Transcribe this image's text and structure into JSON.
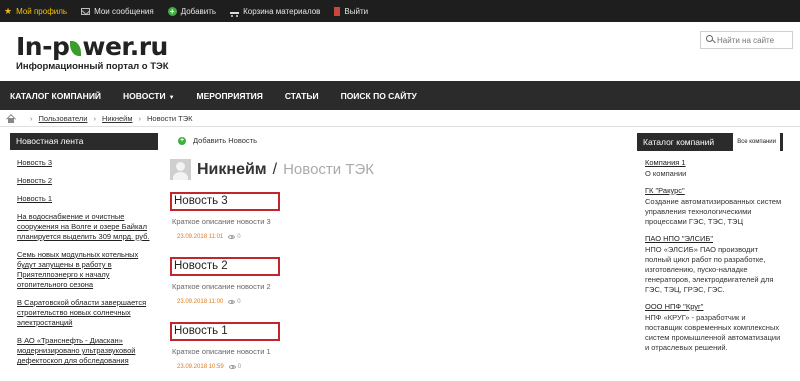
{
  "topbar": {
    "items": [
      {
        "label": "Мой профиль",
        "icon": "star-icon"
      },
      {
        "label": "Мои сообщения",
        "icon": "mail-icon"
      },
      {
        "label": "Добавить",
        "icon": "plus-icon"
      },
      {
        "label": "Корзина материалов",
        "icon": "cart-icon"
      },
      {
        "label": "Выйти",
        "icon": "exit-icon"
      }
    ],
    "active_color": "#f2c200"
  },
  "header": {
    "logo_left": "In-p",
    "logo_right": "wer.ru",
    "tagline": "Информационный портал о ТЭК",
    "search_placeholder": "Найти на сайте"
  },
  "nav": {
    "items": [
      "КАТАЛОГ КОМПАНИЙ",
      "НОВОСТИ",
      "МЕРОПРИЯТИЯ",
      "СТАТЬИ",
      "ПОИСК ПО САЙТУ"
    ]
  },
  "breadcrumb": {
    "items": [
      "Пользователи",
      "Никнейм",
      "Новости ТЭК"
    ]
  },
  "left": {
    "title": "Новостная лента",
    "items": [
      "Новость 3",
      "Новость 2",
      "Новость 1",
      "На водоснабжение и очистные сооружения на Волге и озере Байкал планируется выделить 309 млрд. руб.",
      "Семь новых модульных котельных будут запущены в работу в Приятелпоэнерго к началу отопительного сезона",
      "В Саратовской области завершается строительство новых солнечных электростанций",
      "В АО «Транснефть - Диаскан» модернизировано ультразвуковой дефектоскоп для обследования"
    ]
  },
  "center": {
    "add_label": "Добавить Новость",
    "nickname": "Никнейм",
    "slash": "/",
    "section": "Новости ТЭК",
    "posts": [
      {
        "title": "Новость 3",
        "desc": "Краткое описание новости 3",
        "date": "23.09.2018 11:01",
        "views": "0"
      },
      {
        "title": "Новость 2",
        "desc": "Краткое описание новости 2",
        "date": "23.09.2018 11:00",
        "views": "0"
      },
      {
        "title": "Новость 1",
        "desc": "Краткое описание новости 1",
        "date": "23.09.2018 10:59",
        "views": "0"
      }
    ],
    "highlight_color": "#c0262c"
  },
  "right": {
    "title": "Каталог компаний",
    "all_label": "Все компании",
    "companies": [
      {
        "name": "Компания 1",
        "desc": "О компании"
      },
      {
        "name": "ГК \"Ракурс\"",
        "desc": "Создание автоматизированных систем управления технологическими процессами ГЭС, ТЭС, ТЭЦ"
      },
      {
        "name": "ПАО НПО \"ЭЛСИБ\"",
        "desc": "НПО «ЭЛСИБ» ПАО производит полный цикл работ по разработке, изготовлению, пуско-наладке генераторов, электродвигателей для ГЭС, ТЭЦ, ГРЭС, ГЭС."
      },
      {
        "name": "ООО НПФ \"Круг\"",
        "desc": "НПФ «КРУГ» - разработчик и поставщик современных комплексных систем промышленной автоматизации и отраслевых решений."
      }
    ]
  }
}
